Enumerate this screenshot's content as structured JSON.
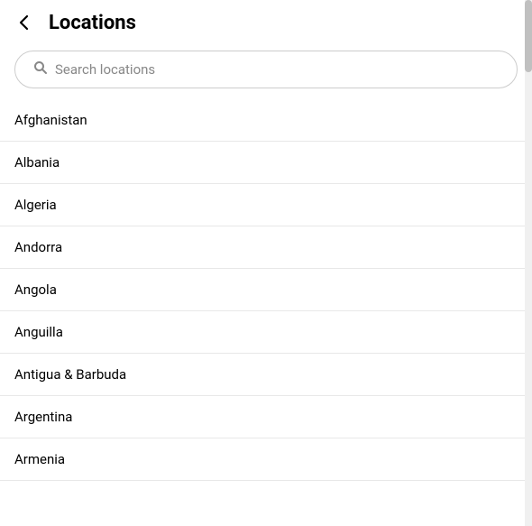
{
  "header": {
    "title": "Locations",
    "back_label": "←"
  },
  "search": {
    "placeholder": "Search locations"
  },
  "locations": [
    {
      "name": "Afghanistan"
    },
    {
      "name": "Albania"
    },
    {
      "name": "Algeria"
    },
    {
      "name": "Andorra"
    },
    {
      "name": "Angola"
    },
    {
      "name": "Anguilla"
    },
    {
      "name": "Antigua & Barbuda"
    },
    {
      "name": "Argentina"
    },
    {
      "name": "Armenia"
    }
  ]
}
